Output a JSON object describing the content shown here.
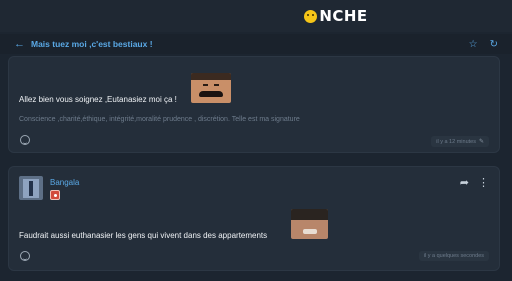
{
  "brand": {
    "name": "NCHE",
    "logo_icon": "smiley-icon"
  },
  "topic": {
    "back_icon": "arrow-left-icon",
    "title": "Mais tuez moi ,c'est bestiaux !",
    "star_icon": "star-icon",
    "refresh_icon": "refresh-icon"
  },
  "posts": [
    {
      "text": "Allez bien vous soignez ,Eutanasiez moi ça !",
      "sticker": "mustache-face-sticker",
      "signature": "Conscience ,charité,éthique, intégrité,moralité prudence , discrétion. Telle est ma signature",
      "timestamp": "il y a 12 minutes",
      "edit_icon": "pencil-icon"
    },
    {
      "username": "Bangala",
      "text": "Faudrait aussi euthanasier les gens qui vivent dans des appartements",
      "sticker": "laughing-face-sticker",
      "timestamp": "il y a quelques secondes"
    }
  ]
}
